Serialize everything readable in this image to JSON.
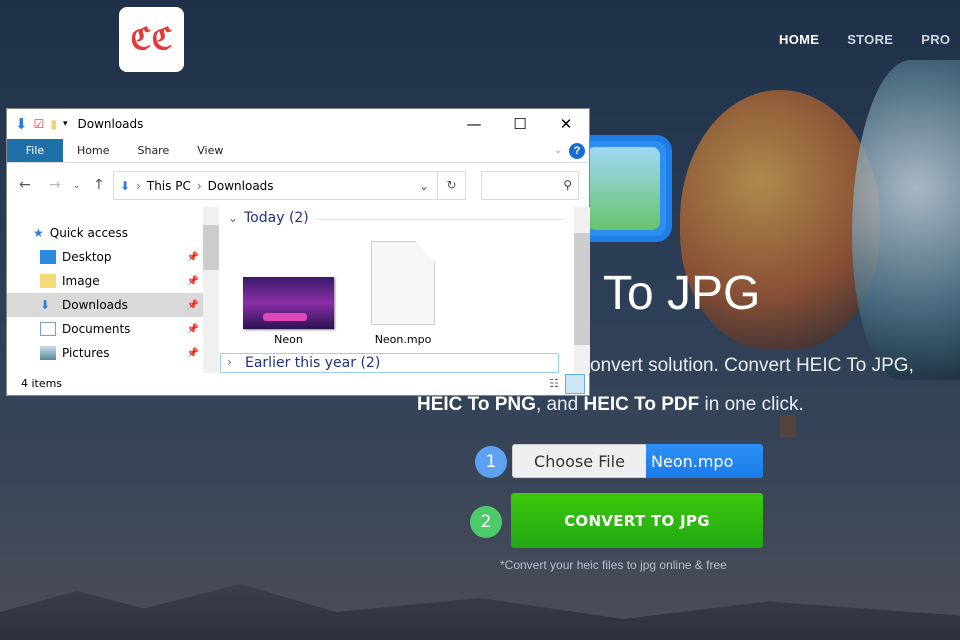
{
  "site": {
    "logo_text": "cc",
    "nav": [
      "HOME",
      "STORE",
      "PRO"
    ],
    "title": "To JPG",
    "subtitle_line1": "onvert solution. Convert HEIC To JPG,",
    "subtitle_line2": {
      "b1": "HEIC To PNG",
      "t1": ", and ",
      "b2": "HEIC To PDF",
      "t2": " in one click."
    },
    "step1": "1",
    "step2": "2",
    "choose_file": "Choose File",
    "file_name": "Neon.mpo",
    "convert": "CONVERT TO JPG",
    "note": "*Convert your heic files to jpg online & free"
  },
  "explorer": {
    "title": "Downloads",
    "ribbon": [
      "File",
      "Home",
      "Share",
      "View"
    ],
    "breadcrumb": [
      "This PC",
      "Downloads"
    ],
    "sidebar": [
      {
        "label": "Quick access"
      },
      {
        "label": "Desktop"
      },
      {
        "label": "Image"
      },
      {
        "label": "Downloads"
      },
      {
        "label": "Documents"
      },
      {
        "label": "Pictures"
      }
    ],
    "groups": [
      "Today (2)",
      "Earlier this year (2)"
    ],
    "files": [
      "Neon",
      "Neon.mpo"
    ],
    "status": "4 items"
  }
}
